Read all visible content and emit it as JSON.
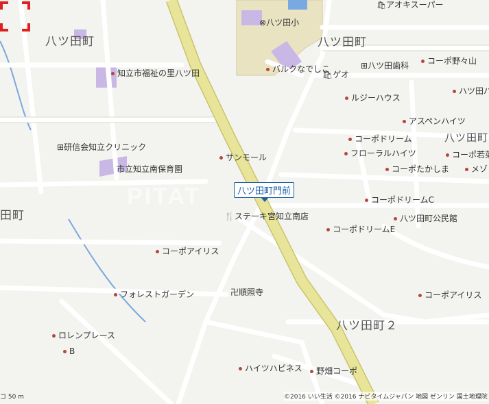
{
  "map": {
    "area_labels": [
      {
        "id": "hatsuta-nw",
        "text": "八ツ田町"
      },
      {
        "id": "hatsuta-ne",
        "text": "八ツ田町"
      },
      {
        "id": "hatsuta-2",
        "text": "八ツ田町２"
      },
      {
        "id": "hatsuta-w",
        "text": "田町"
      }
    ],
    "poi": [
      {
        "id": "aoki",
        "text": "アオキスーパー",
        "icon": "shop-icon"
      },
      {
        "id": "hatsuta-elem",
        "text": "八ツ田小",
        "icon": "school-icon"
      },
      {
        "id": "fukushi",
        "text": "知立市福祉の里八ツ田",
        "icon": "facility-icon"
      },
      {
        "id": "bulk",
        "text": "バルクなでしこ",
        "icon": "dot-icon"
      },
      {
        "id": "geo",
        "text": "ゲオ",
        "icon": "shop-icon"
      },
      {
        "id": "hatsuta-dental",
        "text": "八ツ田歯科",
        "icon": "clinic-icon"
      },
      {
        "id": "nomiyama",
        "text": "コーポ野々山",
        "icon": "dot-icon"
      },
      {
        "id": "hatsuta-h",
        "text": "ハツ田ハ",
        "icon": "dot-icon"
      },
      {
        "id": "luzy",
        "text": "ルジーハウス",
        "icon": "dot-icon"
      },
      {
        "id": "aspen",
        "text": "アスペンハイツ",
        "icon": "dot-icon"
      },
      {
        "id": "hatsuta-rt",
        "text": "八ツ田町",
        "icon": "none"
      },
      {
        "id": "kenshin",
        "text": "研信会知立クリニック",
        "icon": "clinic-icon"
      },
      {
        "id": "dream1",
        "text": "コーポドリーム",
        "icon": "dot-icon"
      },
      {
        "id": "wakana",
        "text": "コーポ若菜",
        "icon": "dot-icon"
      },
      {
        "id": "floral",
        "text": "フローラルハイツ",
        "icon": "dot-icon"
      },
      {
        "id": "takashima",
        "text": "コーポたかしま",
        "icon": "dot-icon"
      },
      {
        "id": "mezon",
        "text": "メゾ",
        "icon": "dot-icon"
      },
      {
        "id": "sunmall",
        "text": "サンモール",
        "icon": "dot-icon"
      },
      {
        "id": "nursery",
        "text": "市立知立南保育園",
        "icon": "none"
      },
      {
        "id": "dreamC",
        "text": "コーポドリームC",
        "icon": "dot-icon"
      },
      {
        "id": "hall",
        "text": "八ツ田町公民館",
        "icon": "dot-icon"
      },
      {
        "id": "steak",
        "text": "ステーキ宮知立南店",
        "icon": "restaurant-icon"
      },
      {
        "id": "dreamE",
        "text": "コーポドリームE",
        "icon": "dot-icon"
      },
      {
        "id": "iris1",
        "text": "コーポアイリス",
        "icon": "dot-icon"
      },
      {
        "id": "forest",
        "text": "フォレストガーデン",
        "icon": "dot-icon"
      },
      {
        "id": "junkoji",
        "text": "順照寺",
        "icon": "temple-icon"
      },
      {
        "id": "iris2",
        "text": "コーポアイリス",
        "icon": "dot-icon"
      },
      {
        "id": "lorenplace",
        "text": "ロレンプレース",
        "icon": "dot-icon"
      },
      {
        "id": "b",
        "text": "B",
        "icon": "dot-icon"
      },
      {
        "id": "heights",
        "text": "ハイツハピネス",
        "icon": "dot-icon"
      },
      {
        "id": "nobata",
        "text": "野畑コーポ",
        "icon": "dot-icon"
      }
    ],
    "selected_callout": "八ツ田町門前",
    "watermark": "PITAT",
    "copyright": "©2016 いい生活 ©2016 ナビタイムジャパン 地図 ゼンリン 国土地理院",
    "scale": "コ 50 m",
    "colors": {
      "highway": "#e8e59a",
      "highway_edge": "#c9c46a",
      "water": "#7aa8e0",
      "facility": "#c9b8e6",
      "school_ground": "#e9e3c2",
      "road": "#ffffff",
      "road_edge": "#cfcfc6",
      "marker": "#e02020",
      "callout": "#1b5fa8"
    }
  }
}
